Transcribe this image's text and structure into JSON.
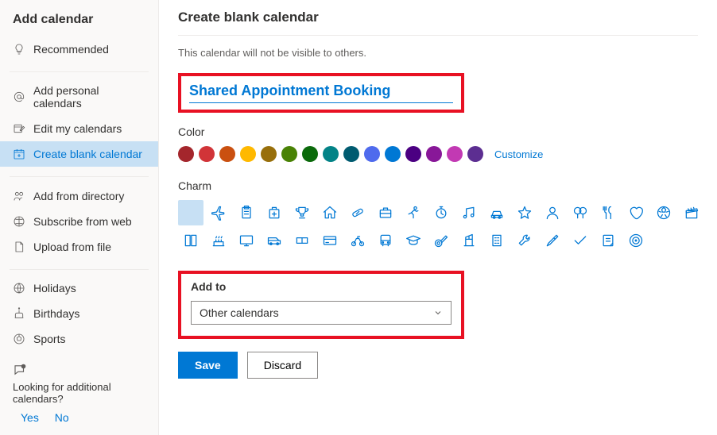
{
  "sidebar": {
    "title": "Add calendar",
    "items": [
      {
        "label": "Recommended",
        "icon": "lightbulb"
      },
      {
        "label": "Add personal calendars",
        "icon": "at"
      },
      {
        "label": "Edit my calendars",
        "icon": "edit-cal"
      },
      {
        "label": "Create blank calendar",
        "icon": "blank-cal",
        "active": true
      },
      {
        "label": "Add from directory",
        "icon": "directory"
      },
      {
        "label": "Subscribe from web",
        "icon": "web"
      },
      {
        "label": "Upload from file",
        "icon": "file"
      },
      {
        "label": "Holidays",
        "icon": "globe"
      },
      {
        "label": "Birthdays",
        "icon": "cake"
      },
      {
        "label": "Sports",
        "icon": "sports"
      }
    ],
    "foot_text": "Looking for additional calendars?",
    "foot_yes": "Yes",
    "foot_no": "No"
  },
  "main": {
    "title": "Create blank calendar",
    "subtext": "This calendar will not be visible to others.",
    "calendar_name": "Shared Appointment Booking",
    "color_label": "Color",
    "colors": [
      "#a4262c",
      "#d13438",
      "#ca5010",
      "#ffb900",
      "#986f0b",
      "#498205",
      "#0b6a0b",
      "#038387",
      "#005b70",
      "#4f6bed",
      "#0078d4",
      "#4b0082",
      "#881798",
      "#c239b3",
      "#5c2e91"
    ],
    "customize": "Customize",
    "charm_label": "Charm",
    "charms": [
      "none",
      "plane",
      "clipboard",
      "medical",
      "trophy",
      "home",
      "pill",
      "briefcase",
      "running",
      "stopwatch",
      "music",
      "car",
      "star",
      "person",
      "balloon",
      "food",
      "heart",
      "soccer",
      "clapper",
      "book",
      "cake",
      "monitor",
      "van",
      "ticket",
      "credit-card",
      "bike",
      "bus",
      "grad",
      "guitar",
      "crane",
      "building",
      "wrench",
      "paint",
      "check",
      "note",
      "target"
    ],
    "addto_label": "Add to",
    "addto_value": "Other calendars",
    "save": "Save",
    "discard": "Discard"
  }
}
